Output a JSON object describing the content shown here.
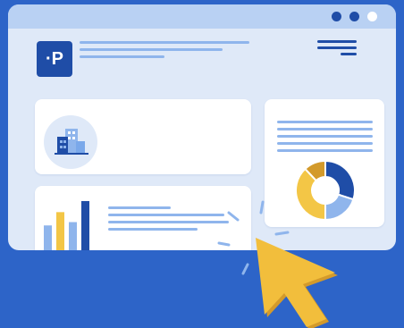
{
  "logo": {
    "text": "·P"
  },
  "icons": {
    "building": "building-icon",
    "bar_chart": "bar-chart-icon",
    "donut_chart": "donut-chart-icon",
    "cursor": "cursor-arrow-icon"
  },
  "colors": {
    "background": "#2d64c8",
    "window": "#dfe9f8",
    "titlebar": "#b9d1f3",
    "accent_dark": "#1f4da7",
    "accent_light": "#8fb5ec",
    "accent_mid": "#7aa8ea",
    "yellow": "#f3c646",
    "yellow_dark": "#d39a2b",
    "cursor": "#f2be3c"
  },
  "titlebar_dots": [
    {
      "name": "window-dot-1",
      "color": "#1f4da7"
    },
    {
      "name": "window-dot-2",
      "color": "#1f4da7"
    },
    {
      "name": "window-dot-3",
      "color": "#ffffff"
    }
  ],
  "bar_chart": {
    "values": [
      2.4,
      3.6,
      2.7,
      4.6
    ],
    "max": 5
  },
  "donut_chart": {
    "segments": [
      {
        "name": "donut-segment-dark-blue",
        "value": 30,
        "color": "#1f4da7"
      },
      {
        "name": "donut-segment-light-blue",
        "value": 20,
        "color": "#8fb5ec"
      },
      {
        "name": "donut-segment-yellow",
        "value": 38,
        "color": "#f3c646"
      },
      {
        "name": "donut-segment-gold",
        "value": 12,
        "color": "#d39a2b"
      }
    ]
  }
}
